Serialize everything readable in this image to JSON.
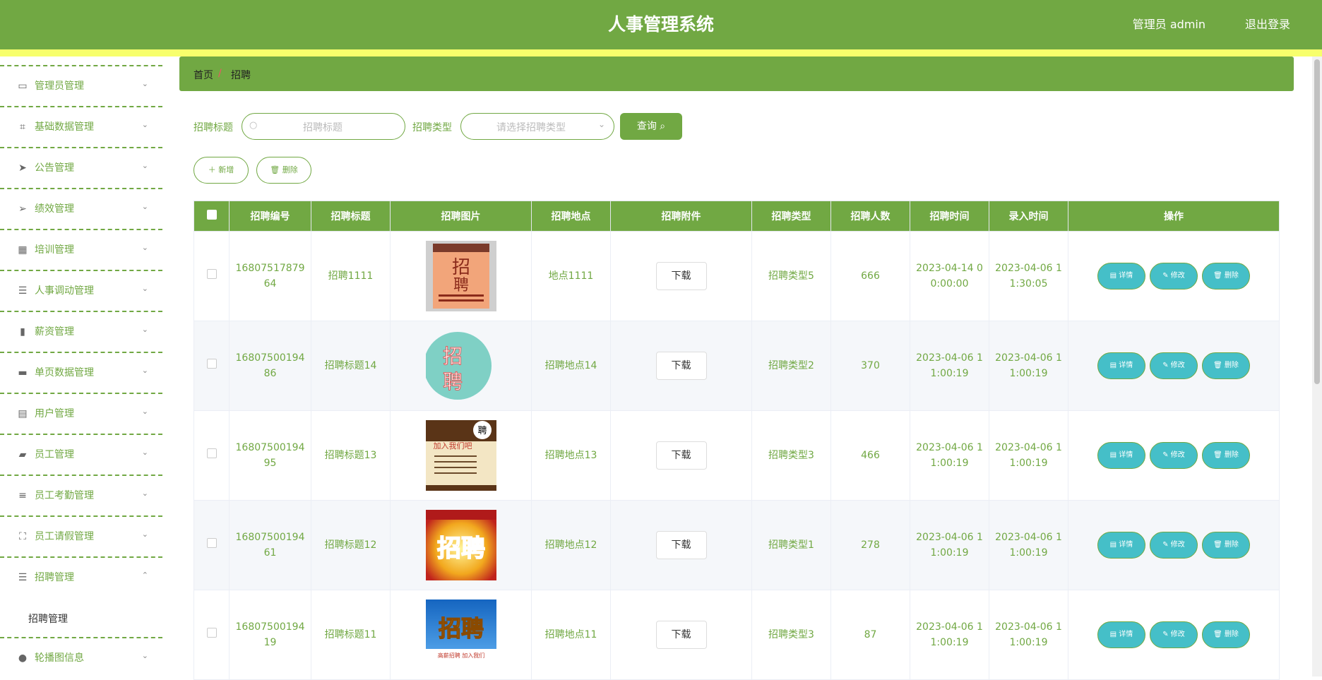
{
  "header": {
    "title": "人事管理系统",
    "user": "管理员 admin",
    "logout": "退出登录"
  },
  "sidebar": {
    "items": [
      {
        "label": "管理员管理",
        "icon": "id-card-icon",
        "glyph": "▭",
        "arrow": "⌄"
      },
      {
        "label": "基础数据管理",
        "icon": "crop-icon",
        "glyph": "⌗",
        "arrow": "⌄"
      },
      {
        "label": "公告管理",
        "icon": "send-icon",
        "glyph": "➤",
        "arrow": "⌄"
      },
      {
        "label": "绩效管理",
        "icon": "navigation-icon",
        "glyph": "➢",
        "arrow": "⌄"
      },
      {
        "label": "培训管理",
        "icon": "grid-icon",
        "glyph": "▦",
        "arrow": "⌄"
      },
      {
        "label": "人事调动管理",
        "icon": "sliders-icon",
        "glyph": "☰",
        "arrow": "⌄"
      },
      {
        "label": "薪资管理",
        "icon": "bar-chart-icon",
        "glyph": "▮",
        "arrow": "⌄"
      },
      {
        "label": "单页数据管理",
        "icon": "message-icon",
        "glyph": "▬",
        "arrow": "⌄"
      },
      {
        "label": "用户管理",
        "icon": "printer-icon",
        "glyph": "▤",
        "arrow": "⌄"
      },
      {
        "label": "员工管理",
        "icon": "briefcase-icon",
        "glyph": "▰",
        "arrow": "⌄"
      },
      {
        "label": "员工考勤管理",
        "icon": "list-icon",
        "glyph": "≡",
        "arrow": "⌄"
      },
      {
        "label": "员工请假管理",
        "icon": "fullscreen-icon",
        "glyph": "⛶",
        "arrow": "⌄"
      },
      {
        "label": "招聘管理",
        "icon": "menu-icon",
        "glyph": "☰",
        "arrow": "⌃"
      },
      {
        "label": "轮播图信息",
        "icon": "user-icon",
        "glyph": "●",
        "arrow": "⌄"
      }
    ],
    "submenu": {
      "label": "招聘管理"
    }
  },
  "breadcrumb": {
    "home": "首页",
    "sep": "/",
    "current": "招聘"
  },
  "search": {
    "title_label": "招聘标题",
    "title_placeholder": "招聘标题",
    "type_label": "招聘类型",
    "type_placeholder": "请选择招聘类型",
    "query_btn": "查询 ⌕"
  },
  "actions": {
    "add": "＋ 新增",
    "delete": "🗑 删除"
  },
  "table": {
    "headers": [
      "招聘编号",
      "招聘标题",
      "招聘图片",
      "招聘地点",
      "招聘附件",
      "招聘类型",
      "招聘人数",
      "招聘时间",
      "录入时间",
      "操作"
    ],
    "download": "下载",
    "ops": {
      "detail": "▤ 详情",
      "edit": "✎ 修改",
      "delete": "🗑 删除"
    },
    "rows": [
      {
        "id": "1680751787964",
        "title": "招聘1111",
        "location": "地点1111",
        "type": "招聘类型5",
        "count": "666",
        "time": "2023-04-14 00:00:00",
        "created": "2023-04-06 11:30:05",
        "img": "poster-brown"
      },
      {
        "id": "1680750019486",
        "title": "招聘标题14",
        "location": "招聘地点14",
        "type": "招聘类型2",
        "count": "370",
        "time": "2023-04-06 11:00:19",
        "created": "2023-04-06 11:00:19",
        "img": "poster-teal"
      },
      {
        "id": "1680750019495",
        "title": "招聘标题13",
        "location": "招聘地点13",
        "type": "招聘类型3",
        "count": "466",
        "time": "2023-04-06 11:00:19",
        "created": "2023-04-06 11:00:19",
        "img": "poster-beige"
      },
      {
        "id": "1680750019461",
        "title": "招聘标题12",
        "location": "招聘地点12",
        "type": "招聘类型1",
        "count": "278",
        "time": "2023-04-06 11:00:19",
        "created": "2023-04-06 11:00:19",
        "img": "poster-red"
      },
      {
        "id": "1680750019419",
        "title": "招聘标题11",
        "location": "招聘地点11",
        "type": "招聘类型3",
        "count": "87",
        "time": "2023-04-06 11:00:19",
        "created": "2023-04-06 11:00:19",
        "img": "poster-blue"
      }
    ]
  },
  "colors": {
    "primary": "#71a843",
    "accent_bar": "#f7ff6c",
    "op_button": "#45bfc8"
  }
}
